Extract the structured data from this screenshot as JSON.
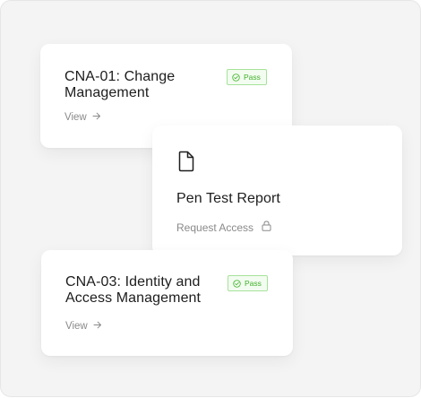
{
  "cards": [
    {
      "title": "CNA-01: Change Management",
      "badge": "Pass",
      "link_label": "View"
    },
    {
      "title": "Pen Test Report",
      "link_label": "Request Access",
      "icon": "document-icon"
    },
    {
      "title": "CNA-03: Identity and Access Management",
      "badge": "Pass",
      "link_label": "View"
    }
  ],
  "colors": {
    "pass_text": "#3fb12a",
    "pass_border": "#a6e29a",
    "pass_bg": "#f3fcf1",
    "muted_text": "#8a8a8a",
    "canvas_bg": "#f4f4f4"
  }
}
